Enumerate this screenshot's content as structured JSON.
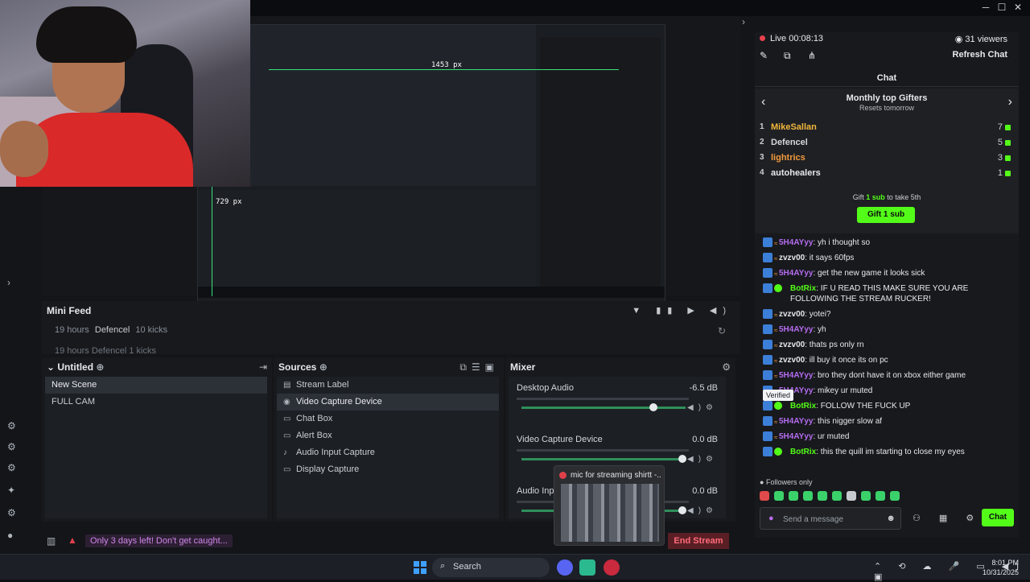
{
  "colors": {
    "accent_green": "#53fc18",
    "live_red": "#e9414d",
    "end_stream_red": "#ff6b7a",
    "purple": "#cf86ea"
  },
  "preview": {
    "width_label": "1453 px",
    "height_label": "729 px"
  },
  "minifeed": {
    "title": "Mini Feed",
    "row1": {
      "time": "19 hours",
      "user": "Defencel",
      "event": "10 kicks"
    },
    "row2": {
      "time": "19 hours",
      "user": "Defencel",
      "event": "1 kicks"
    }
  },
  "scenes": {
    "title": "Untitled",
    "items": [
      "New Scene",
      "FULL CAM"
    ]
  },
  "sources": {
    "title": "Sources",
    "items": [
      {
        "label": "Stream Label",
        "icon": "label-icon"
      },
      {
        "label": "Video Capture Device",
        "icon": "camera-icon"
      },
      {
        "label": "Chat Box",
        "icon": "chat-icon"
      },
      {
        "label": "Alert Box",
        "icon": "alert-icon"
      },
      {
        "label": "Audio Input Capture",
        "icon": "mic-icon"
      },
      {
        "label": "Display Capture",
        "icon": "monitor-icon"
      }
    ]
  },
  "mixer": {
    "title": "Mixer",
    "channels": [
      {
        "name": "Desktop Audio",
        "db": "-6.5 dB",
        "level": 0.82
      },
      {
        "name": "Video Capture Device",
        "db": "0.0 dB",
        "level": 1.0
      },
      {
        "name": "Audio Input",
        "db": "0.0 dB",
        "level": 1.0
      }
    ]
  },
  "status": {
    "warning": "Only 3 days left! Don't get caught...",
    "end_stream": "End Stream"
  },
  "popup": {
    "title": "mic for streaming shirtt -..."
  },
  "chat": {
    "live": "Live 00:08:13",
    "viewers": "31 viewers",
    "refresh": "Refresh Chat",
    "header": "Chat",
    "gifters_title": "Monthly top Gifters",
    "gifters_sub": "Resets tomorrow",
    "gifters": [
      {
        "rank": "1",
        "name": "MikeSallan",
        "count": "7",
        "color": "#f2b73b"
      },
      {
        "rank": "2",
        "name": "Defencel",
        "count": "5",
        "color": "#d3d7db"
      },
      {
        "rank": "3",
        "name": "lightrics",
        "count": "3",
        "color": "#f29a3b"
      },
      {
        "rank": "4",
        "name": "autohealers",
        "count": "1",
        "color": "#e6e9ec"
      }
    ],
    "gift_pre": "Gift",
    "gift_mid": "1 sub",
    "gift_post": "to take 5th",
    "gift_button": "Gift 1 sub",
    "verified_tip": "Verified",
    "messages": [
      {
        "user": "5H4AYyy",
        "text": ": yh i thought so",
        "color": "#b46cf0",
        "special": false
      },
      {
        "user": "zvzv00",
        "text": ": it says 60fps",
        "color": "#e6e9ec",
        "special": false
      },
      {
        "user": "5H4AYyy",
        "text": ": get the new game it looks sick",
        "color": "#b46cf0",
        "special": false
      },
      {
        "user": "BotRix",
        "text": ": IF U READ THIS MAKE SURE YOU ARE FOLLOWING THE STREAM RUCKER!",
        "color": "#53fc18",
        "special": true
      },
      {
        "user": "zvzv00",
        "text": ": yotei?",
        "color": "#e6e9ec",
        "special": false
      },
      {
        "user": "5H4AYyy",
        "text": ": yh",
        "color": "#b46cf0",
        "special": false
      },
      {
        "user": "zvzv00",
        "text": ": thats ps only rn",
        "color": "#e6e9ec",
        "special": false
      },
      {
        "user": "zvzv00",
        "text": ": ill buy it once its on pc",
        "color": "#e6e9ec",
        "special": false
      },
      {
        "user": "5H4AYyy",
        "text": ": bro they dont have it on xbox either game",
        "color": "#b46cf0",
        "special": false
      },
      {
        "user": "5H4AYyy",
        "text": ": mikey ur muted",
        "color": "#b46cf0",
        "special": false
      },
      {
        "user": "BotRix",
        "text": ": FOLLOW THE FUCK UP",
        "color": "#53fc18",
        "special": true
      },
      {
        "user": "5H4AYyy",
        "text": ": this nigger slow af",
        "color": "#b46cf0",
        "special": false
      },
      {
        "user": "5H4AYyy",
        "text": ": ur muted",
        "color": "#b46cf0",
        "special": false
      },
      {
        "user": "BotRix",
        "text": ": this the quill im starting to close my eyes",
        "color": "#53fc18",
        "special": true
      }
    ],
    "followers_only": "Followers only",
    "input_placeholder": "Send a message",
    "chat_button": "Chat"
  },
  "taskbar": {
    "search": "Search",
    "time": "8:01 PM",
    "date": "10/31/2025"
  }
}
